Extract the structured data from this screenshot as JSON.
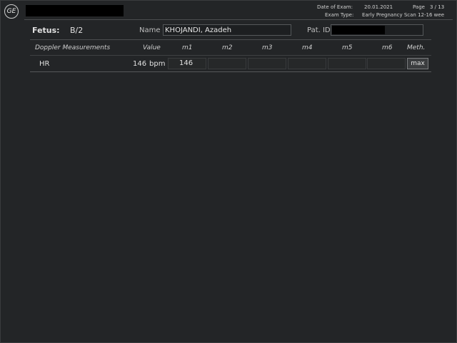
{
  "header": {
    "logo_text": "GE",
    "date_of_exam_label": "Date of Exam:",
    "date_of_exam": "20.01.2021",
    "page_label": "Page",
    "page": "3 / 13",
    "exam_type_label": "Exam Type:",
    "exam_type": "Early Pregnancy Scan 12-16 wee"
  },
  "patient": {
    "fetus_label": "Fetus:",
    "fetus_value": "B/2",
    "name_label": "Name",
    "name_value": "KHOJANDI, Azadeh",
    "pat_id_label": "Pat. ID"
  },
  "table": {
    "title": "Doppler Measurements",
    "columns": [
      "Value",
      "m1",
      "m2",
      "m3",
      "m4",
      "m5",
      "m6",
      "Meth."
    ],
    "rows": [
      {
        "label": "HR",
        "value": "146",
        "unit": "bpm",
        "m": [
          "146",
          "",
          "",
          "",
          "",
          ""
        ],
        "method": "max"
      }
    ]
  },
  "colors": {
    "background": "#232527",
    "text": "#d6d6d6",
    "redaction": "#000000"
  }
}
